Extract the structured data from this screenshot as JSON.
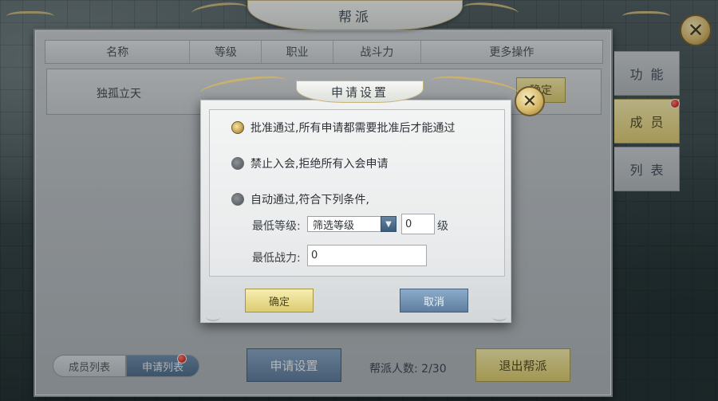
{
  "window": {
    "title": "帮派",
    "close_icon": "close-icon"
  },
  "table": {
    "headers": [
      "名称",
      "等级",
      "职业",
      "战斗力",
      "更多操作"
    ],
    "rows": [
      {
        "name": "独孤立天",
        "action_label": "确定"
      }
    ]
  },
  "side_tabs": [
    {
      "label": "功能",
      "active": false
    },
    {
      "label": "成员",
      "active": true,
      "badge": true
    },
    {
      "label": "列表",
      "active": false
    }
  ],
  "bottom": {
    "tab_members": "成员列表",
    "tab_applications": "申请列表",
    "apply_settings_label": "申请设置",
    "member_count": "帮派人数: 2/30",
    "quit_label": "退出帮派"
  },
  "dialog": {
    "title": "申请设置",
    "options": [
      {
        "label": "批准通过,所有申请都需要批准后才能通过",
        "checked": true
      },
      {
        "label": "禁止入会,拒绝所有入会申请",
        "checked": false
      },
      {
        "label": "自动通过,符合下列条件,",
        "checked": false
      }
    ],
    "min_level_label": "最低等级:",
    "level_select_value": "筛选等级",
    "level_input_value": "0",
    "level_unit": "级",
    "min_power_label": "最低战力:",
    "power_input_value": "0",
    "ok_label": "确定",
    "cancel_label": "取消"
  },
  "colors": {
    "accent_gold": "#d8c86b",
    "accent_blue": "#5a7898",
    "badge_red": "#d4271c"
  }
}
